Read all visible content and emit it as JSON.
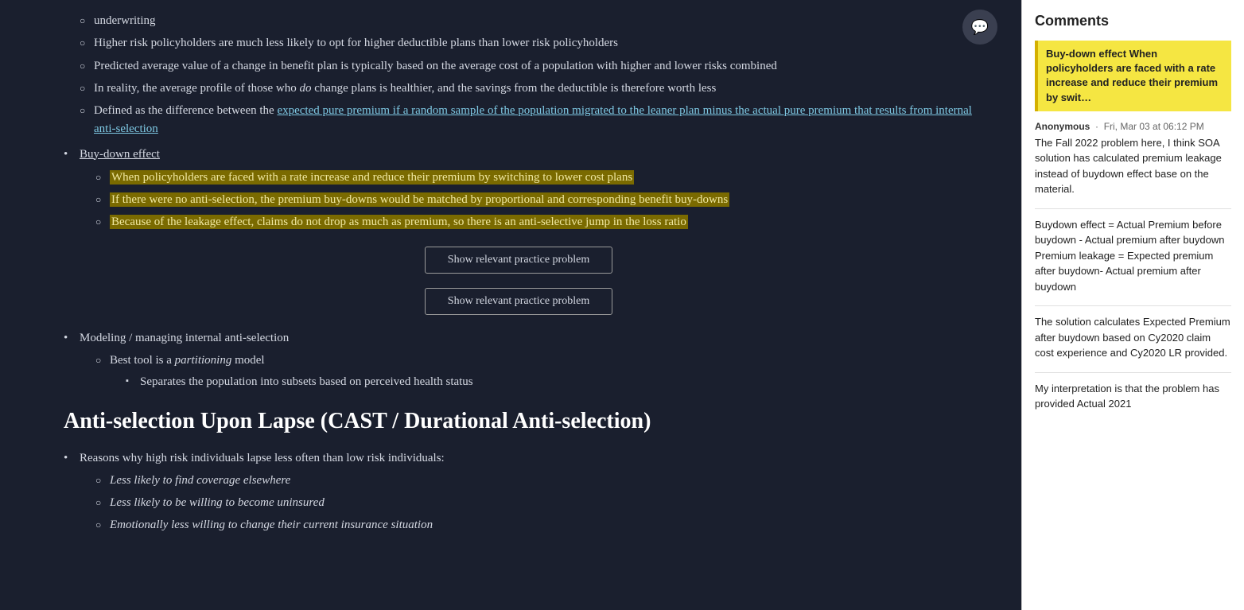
{
  "main": {
    "bullets_intro": [
      {
        "text": "underwriting",
        "level": 2
      },
      {
        "text": "Higher risk policyholders are much less likely to opt for higher deductible plans than lower risk policyholders",
        "level": 2
      },
      {
        "text": "Predicted average value of a change in benefit plan is typically based on the average cost of a population with higher and lower risks combined",
        "level": 2
      },
      {
        "text_parts": [
          {
            "text": "In reality, the average profile of those who ",
            "style": "normal"
          },
          {
            "text": "do",
            "style": "italic"
          },
          {
            "text": " change plans is healthier, and the savings from the deductible is therefore worth less",
            "style": "normal"
          }
        ],
        "level": 2
      },
      {
        "text_parts": [
          {
            "text": "Defined as the difference between the ",
            "style": "normal"
          },
          {
            "text": "expected pure premium if a random sample of the population migrated to the leaner plan minus the actual pure premium that results from internal anti-selection",
            "style": "underline-link"
          }
        ],
        "level": 2
      }
    ],
    "buydown_label": "Buy-down effect",
    "buydown_bullets": [
      {
        "text": "When policyholders are faced with a rate increase and reduce their premium by switching to lower cost plans",
        "highlighted": true
      },
      {
        "text": "If there were no anti-selection, the premium buy-downs would be matched by proportional and corresponding benefit buy-downs",
        "highlighted": true
      },
      {
        "text": "Because of the leakage effect, claims do not drop as much as premium, so there is an anti-selective jump in the loss ratio",
        "highlighted": true
      }
    ],
    "practice_btn_1": "Show relevant practice problem",
    "practice_btn_2": "Show relevant practice problem",
    "modeling_label": "Modeling / managing internal anti-selection",
    "modeling_bullets": [
      {
        "text_parts": [
          {
            "text": "Best tool is a ",
            "style": "normal"
          },
          {
            "text": "partitioning",
            "style": "italic"
          },
          {
            "text": " model",
            "style": "normal"
          }
        ]
      }
    ],
    "partitioning_sub": [
      {
        "text": "Separates the population into subsets based on perceived health status"
      }
    ],
    "section_heading": "Anti-selection Upon Lapse (CAST / Durational Anti-selection)",
    "lapse_bullets": [
      {
        "text": "Reasons why high risk individuals lapse less often than low risk individuals:"
      }
    ],
    "lapse_sub": [
      {
        "text": "Less likely to find coverage elsewhere",
        "italic": true
      },
      {
        "text": "Less likely to be willing to become uninsured",
        "italic": true
      },
      {
        "text": "Emotionally less willing to change their current insurance situation",
        "italic": true
      }
    ]
  },
  "comment_icon": "💬",
  "comments": {
    "title": "Comments",
    "highlight_quote": "Buy-down effect When policyholders are faced with a rate increase and reduce their premium by swit…",
    "entries": [
      {
        "commenter": "Anonymous",
        "date": "Fri, Mar 03 at 06:12 PM",
        "text": "The Fall 2022 problem here, I think SOA solution has calculated premium leakage instead of buydown effect base on the material."
      },
      {
        "text": "Buydown effect = Actual Premium before buydown - Actual premium after buydown\nPremium leakage = Expected premium after buydown- Actual premium after buydown"
      },
      {
        "text": "The solution calculates Expected Premium after buydown based on Cy2020 claim cost experience and Cy2020 LR provided."
      },
      {
        "text": "My interpretation is that the problem has provided Actual 2021"
      }
    ]
  }
}
